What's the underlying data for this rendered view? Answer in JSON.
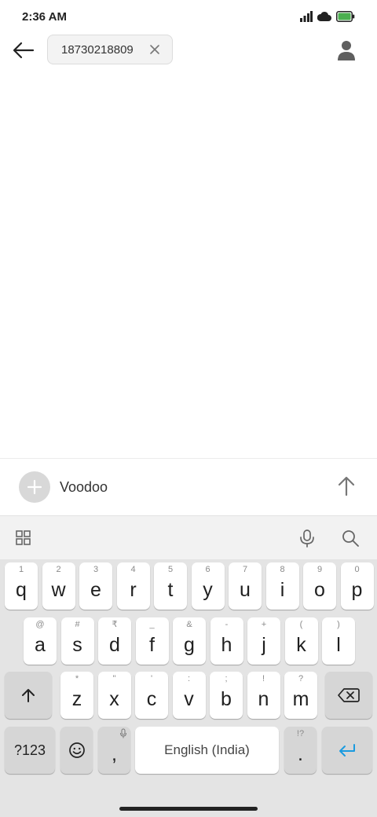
{
  "status_bar": {
    "time": "2:36 AM",
    "icons": [
      "signal-icon",
      "cloud-icon",
      "battery-icon"
    ],
    "battery_color": "#4caf50"
  },
  "header": {
    "recipient": "18730218809",
    "icons": [
      "back-arrow-icon",
      "close-icon",
      "contact-person-icon"
    ]
  },
  "compose": {
    "text": "Voodoo",
    "icons": [
      "plus-icon",
      "send-arrow-up-icon"
    ]
  },
  "keyboard_toolbar": {
    "icons": [
      "grid-icon",
      "microphone-icon",
      "search-icon"
    ]
  },
  "keyboard": {
    "row1": [
      {
        "main": "q",
        "hint": "1"
      },
      {
        "main": "w",
        "hint": "2"
      },
      {
        "main": "e",
        "hint": "3"
      },
      {
        "main": "r",
        "hint": "4"
      },
      {
        "main": "t",
        "hint": "5"
      },
      {
        "main": "y",
        "hint": "6"
      },
      {
        "main": "u",
        "hint": "7"
      },
      {
        "main": "i",
        "hint": "8"
      },
      {
        "main": "o",
        "hint": "9"
      },
      {
        "main": "p",
        "hint": "0"
      }
    ],
    "row2": [
      {
        "main": "a",
        "hint": "@"
      },
      {
        "main": "s",
        "hint": "#"
      },
      {
        "main": "d",
        "hint": "₹"
      },
      {
        "main": "f",
        "hint": "_"
      },
      {
        "main": "g",
        "hint": "&"
      },
      {
        "main": "h",
        "hint": "-"
      },
      {
        "main": "j",
        "hint": "+"
      },
      {
        "main": "k",
        "hint": "("
      },
      {
        "main": "l",
        "hint": ")"
      }
    ],
    "row3": [
      {
        "main": "z",
        "hint": "*"
      },
      {
        "main": "x",
        "hint": "\""
      },
      {
        "main": "c",
        "hint": "'"
      },
      {
        "main": "v",
        "hint": ":"
      },
      {
        "main": "b",
        "hint": ";"
      },
      {
        "main": "n",
        "hint": "!"
      },
      {
        "main": "m",
        "hint": "?"
      }
    ],
    "symbols_label": "?123",
    "comma": {
      "main": ",",
      "hint_icon": "microphone-icon"
    },
    "space_label": "English (India)",
    "period": {
      "main": ".",
      "hint": "!?"
    },
    "accent_color": "#1a9be0"
  }
}
